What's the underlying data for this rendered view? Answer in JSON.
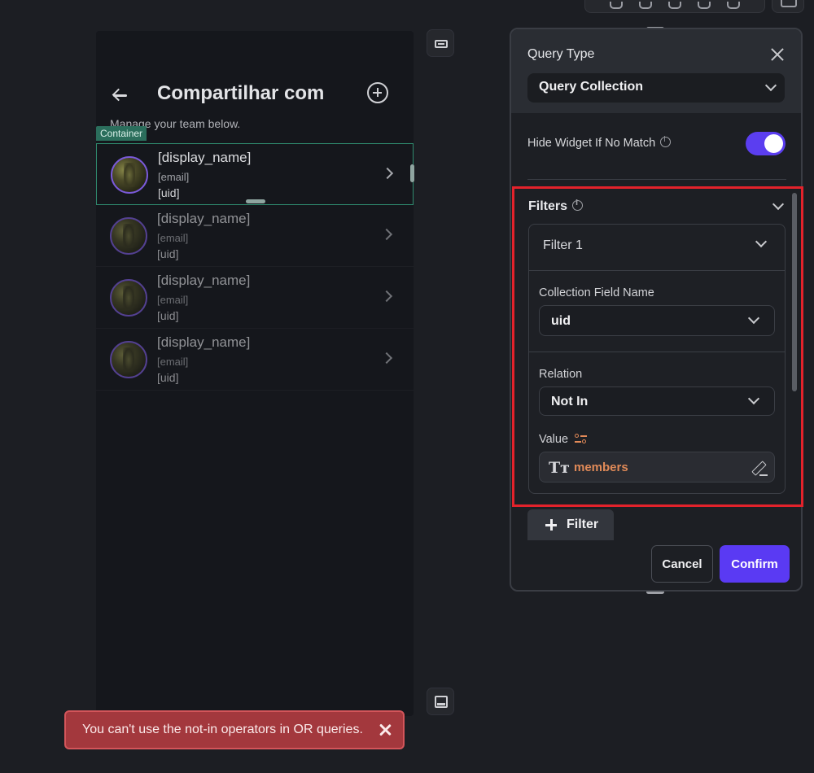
{
  "phone": {
    "title": "Compartilhar com",
    "subtitle": "Manage your team below.",
    "container_tag": "Container",
    "rows": [
      {
        "name": "[display_name]",
        "email": "[email]",
        "uid": "[uid]"
      },
      {
        "name": "[display_name]",
        "email": "[email]",
        "uid": "[uid]"
      },
      {
        "name": "[display_name]",
        "email": "[email]",
        "uid": "[uid]"
      },
      {
        "name": "[display_name]",
        "email": "[email]",
        "uid": "[uid]"
      }
    ]
  },
  "toast": {
    "message": "You can't use the not-in operators in OR queries."
  },
  "panel": {
    "query_type_label": "Query Type",
    "query_type_value": "Query Collection",
    "hide_widget_label": "Hide Widget If No Match",
    "hide_widget_enabled": true,
    "filters_label": "Filters",
    "filter": {
      "title": "Filter 1",
      "field_label": "Collection Field Name",
      "field_value": "uid",
      "relation_label": "Relation",
      "relation_value": "Not In",
      "value_label": "Value",
      "value_type_icon": "Tт",
      "value_text": "members"
    },
    "add_filter_label": "Filter",
    "cancel_label": "Cancel",
    "confirm_label": "Confirm"
  },
  "colors": {
    "accent": "#5a3af3",
    "highlight_border": "#e3222b",
    "error_toast": "#a3383d",
    "variable_orange": "#e08a58",
    "selection_green": "#2f8a6e"
  },
  "icons": [
    "back-arrow-icon",
    "add-circle-icon",
    "chevron-right-icon",
    "close-icon",
    "chevron-down-icon",
    "info-icon",
    "variable-icon",
    "text-type-icon",
    "edit-icon",
    "plus-icon",
    "widget-icon",
    "screen-icon"
  ]
}
